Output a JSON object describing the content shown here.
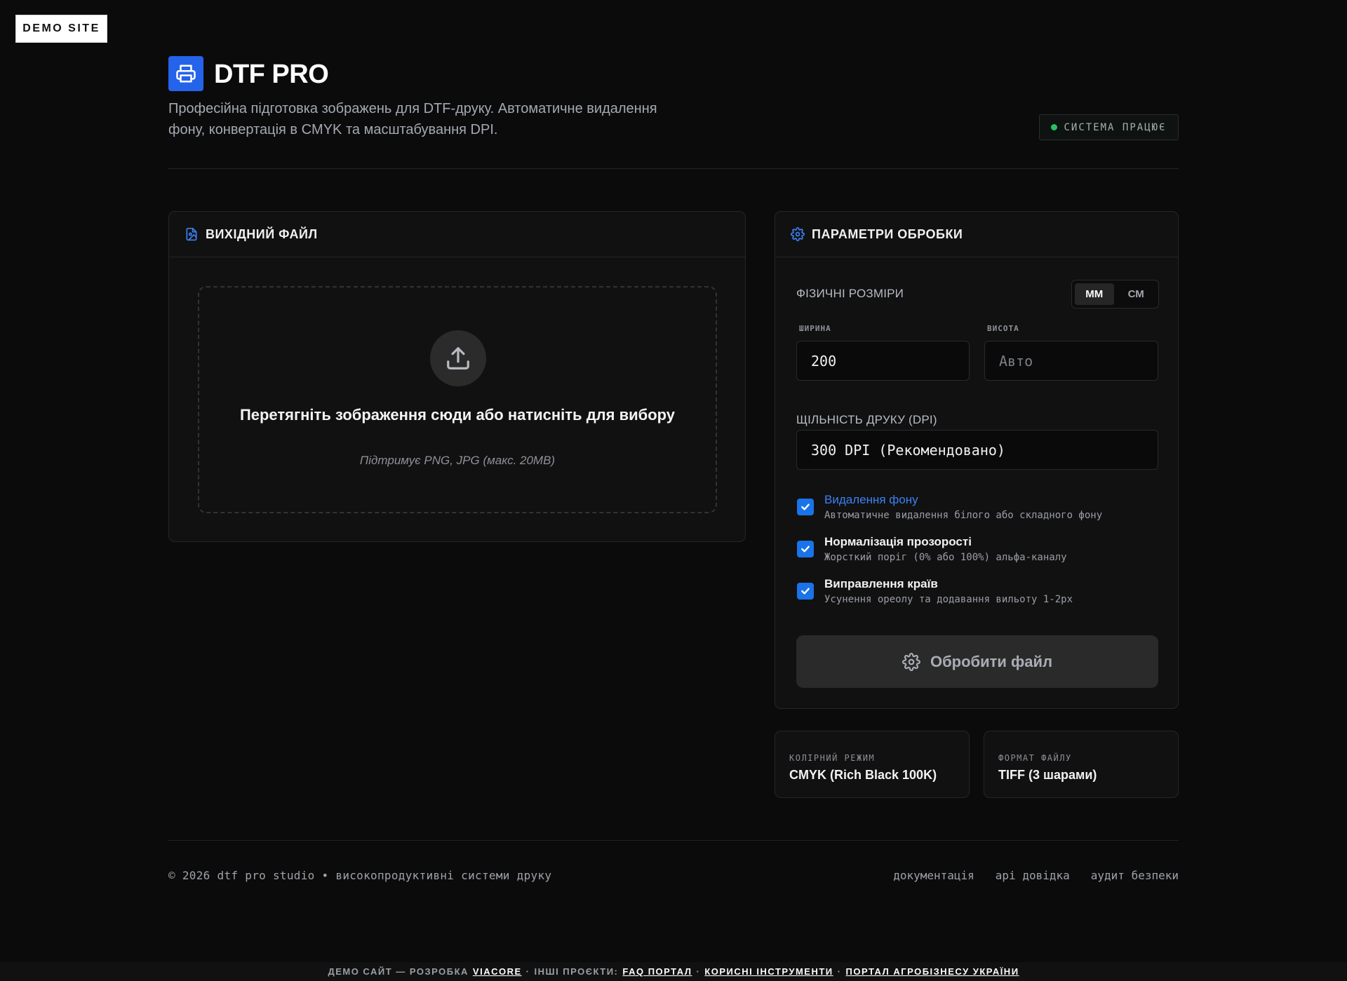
{
  "demo_badge": "DEMO SITE",
  "header": {
    "title": "DTF PRO",
    "description": "Професійна підготовка зображень для DTF-друку. Автоматичне видалення фону, конвертація в CMYK та масштабування DPI.",
    "status": "СИСТЕМА ПРАЦЮЄ"
  },
  "source_card": {
    "title": "ВИХІДНИЙ ФАЙЛ",
    "drop_text": "Перетягніть зображення сюди або натисніть для вибору",
    "drop_hint": "Підтримує PNG, JPG (макс. 20MB)"
  },
  "params_card": {
    "title": "ПАРАМЕТРИ ОБРОБКИ",
    "dimensions_label": "ФІЗИЧНІ РОЗМІРИ",
    "units": [
      "ММ",
      "СМ"
    ],
    "active_unit": "ММ",
    "width_label": "ШИРИНА",
    "width_value": "200",
    "height_label": "ВИСОТА",
    "height_placeholder": "Авто",
    "dpi_label": "ЩІЛЬНІСТЬ ДРУКУ (DPI)",
    "dpi_value": "300 DPI (Рекомендовано)",
    "options": [
      {
        "title": "Видалення фону",
        "desc": "Автоматичне видалення білого або складного фону",
        "checked": true
      },
      {
        "title": "Нормалізація прозорості",
        "desc": "Жорсткий поріг (0% або 100%) альфа-каналу",
        "checked": true
      },
      {
        "title": "Виправлення країв",
        "desc": "Усунення ореолу та додавання вильоту 1-2px",
        "checked": true
      }
    ],
    "process_button": "Обробити файл"
  },
  "info": {
    "color_mode_label": "КОЛІРНИЙ РЕЖИМ",
    "color_mode_value": "CMYK (Rich Black 100K)",
    "format_label": "ФОРМАТ ФАЙЛУ",
    "format_value": "TIFF (3 шарами)"
  },
  "footer": {
    "copyright": "© 2026 dtf pro studio • високопродуктивні системи друку",
    "links": [
      "документація",
      "api довідка",
      "аудит безпеки"
    ]
  },
  "bottom_bar": {
    "prefix": "ДЕМО САЙТ — РОЗРОБКА",
    "dev_link": "VIACORE",
    "others_label": "ІНШІ ПРОЄКТИ:",
    "projects": [
      "FAQ ПОРТАЛ",
      "КОРИСНІ ІНСТРУМЕНТИ",
      "ПОРТАЛ АГРОБІЗНЕСУ УКРАЇНИ"
    ]
  },
  "colors": {
    "accent": "#2563eb",
    "checkbox": "#1a73e8",
    "status_ok": "#22c55e",
    "background": "#0b0b0b",
    "card": "#111111"
  }
}
